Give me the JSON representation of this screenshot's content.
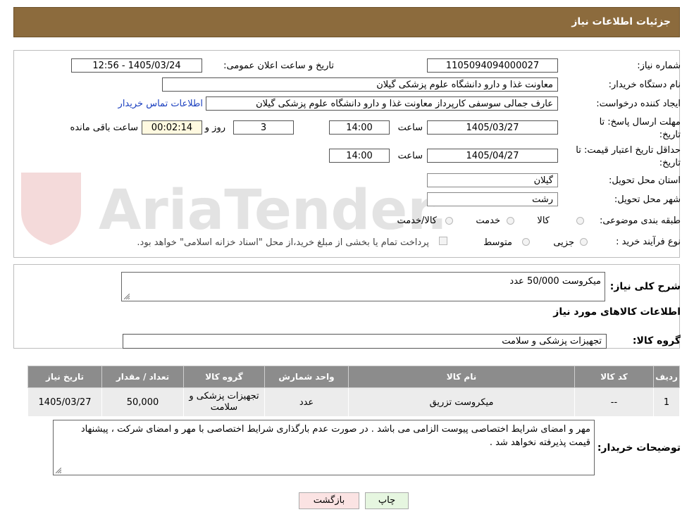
{
  "header": {
    "title": "جزئیات اطلاعات نیاز"
  },
  "watermark": {
    "text": "AriaTender.neT"
  },
  "form": {
    "need_number_label": "شماره نیاز:",
    "need_number": "1105094094000027",
    "announce_label": "تاریخ و ساعت اعلان عمومی:",
    "announce_value": "1405/03/24 - 12:56",
    "buyer_org_label": "نام دستگاه خریدار:",
    "buyer_org": "معاونت غذا و دارو دانشگاه علوم پزشکی گیلان",
    "creator_label": "ایجاد کننده درخواست:",
    "creator": "عارف جمالی سوسفی کارپرداز معاونت غذا و دارو دانشگاه علوم پزشکی گیلان",
    "contact_link": "اطلاعات تماس خریدار",
    "reply_deadline_label_1": "مهلت ارسال پاسخ: تا",
    "reply_deadline_label_2": "تاریخ:",
    "reply_date": "1405/03/27",
    "time_label": "ساعت",
    "reply_time": "14:00",
    "days_value": "3",
    "days_label": "روز و",
    "remaining_time": "00:02:14",
    "remaining_label": "ساعت باقی مانده",
    "price_validity_label_1": "حداقل تاریخ اعتبار قیمت: تا",
    "price_validity_label_2": "تاریخ:",
    "price_validity_date": "1405/04/27",
    "price_validity_time": "14:00",
    "province_label": "استان محل تحویل:",
    "province": "گیلان",
    "city_label": "شهر محل تحویل:",
    "city": "رشت",
    "category_label": "طبقه بندی موضوعی:",
    "category_options": [
      "کالا",
      "خدمت",
      "کالا/خدمت"
    ],
    "process_label": "نوع فرآیند خرید :",
    "process_options": [
      "جزیی",
      "متوسط"
    ],
    "payment_note": "پرداخت تمام یا بخشی از مبلغ خرید،از محل \"اسناد خزانه اسلامی\" خواهد بود."
  },
  "description": {
    "label": "شرح کلی نیاز:",
    "value": "میکروست 50/000 عدد"
  },
  "goods": {
    "section_title": "اطلاعات کالاهای مورد نیاز",
    "group_label": "گروه کالا:",
    "group_value": "تجهیزات پزشکی و سلامت",
    "columns": [
      "ردیف",
      "کد کالا",
      "نام کالا",
      "واحد شمارش",
      "گروه کالا",
      "تعداد / مقدار",
      "تاریخ نیاز"
    ],
    "rows": [
      {
        "row": "1",
        "code": "--",
        "name": "میکروست تزریق",
        "unit": "عدد",
        "group": "تجهیزات پزشکی و سلامت",
        "qty": "50,000",
        "date": "1405/03/27"
      }
    ]
  },
  "buyer_notes": {
    "label": "توضیحات خریدار:",
    "value": "مهر و امضای شرایط اختصاصی پیوست الزامی می باشد . در صورت عدم بارگذاری شرایط اختصاصی با مهر و امضای شرکت ، پیشنهاد قیمت پذیرفته نخواهد شد ."
  },
  "buttons": {
    "print": "چاپ",
    "back": "بازگشت"
  },
  "colors": {
    "header_bg": "#8c6b3d",
    "table_header": "#8c8c8c",
    "link": "#1a3fbf",
    "back_btn_bg": "#fbe3e3",
    "print_btn_bg": "#e6f6e0"
  }
}
